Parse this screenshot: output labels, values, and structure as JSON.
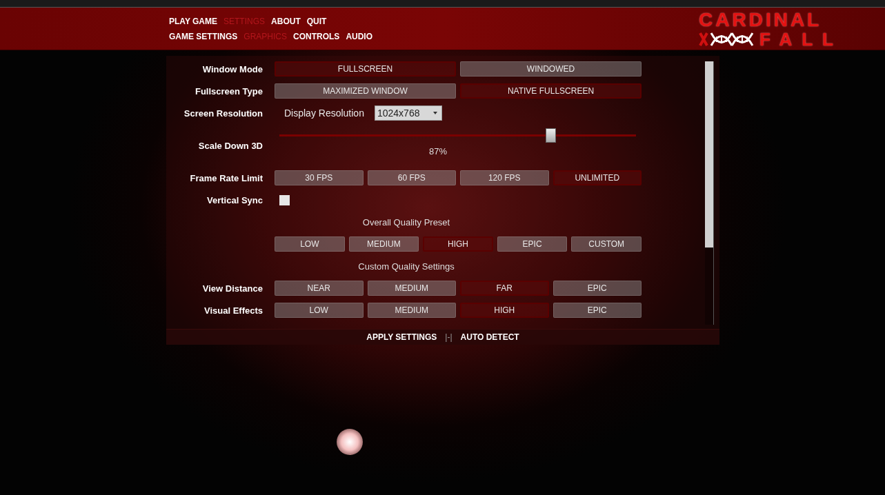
{
  "menu": [
    {
      "label": "PLAY GAME",
      "selected": false
    },
    {
      "label": "SETTINGS",
      "selected": true
    },
    {
      "label": "ABOUT",
      "selected": false
    },
    {
      "label": "QUIT",
      "selected": false
    }
  ],
  "submenu": [
    {
      "label": "GAME SETTINGS",
      "selected": false
    },
    {
      "label": "GRAPHICS",
      "selected": true
    },
    {
      "label": "CONTROLS",
      "selected": false
    },
    {
      "label": "AUDIO",
      "selected": false
    }
  ],
  "logo": {
    "line_1": "CARDINAL",
    "line_2": "FALL"
  },
  "rows": [
    {
      "kind": "options",
      "label": "Window Mode",
      "options": [
        {
          "label": "FULLSCREEN",
          "selected": true
        },
        {
          "label": "WINDOWED",
          "selected": false
        }
      ]
    },
    {
      "kind": "options",
      "label": "Fullscreen Type",
      "options": [
        {
          "label": "MAXIMIZED WINDOW",
          "selected": false
        },
        {
          "label": "NATIVE FULLSCREEN",
          "selected": true
        }
      ]
    },
    {
      "kind": "dropdown",
      "label": "Screen Resolution",
      "field_label": "Display Resolution",
      "value": "1024x768"
    },
    {
      "kind": "slider",
      "label": "Scale Down 3D",
      "level": 0.76,
      "reading": "87%"
    },
    {
      "kind": "options",
      "label": "Frame Rate Limit",
      "options": [
        {
          "label": "30 FPS",
          "selected": false
        },
        {
          "label": "60 FPS",
          "selected": false
        },
        {
          "label": "120 FPS",
          "selected": false
        },
        {
          "label": "UNLIMITED",
          "selected": true
        }
      ]
    },
    {
      "kind": "checkbox",
      "label": "Vertical Sync",
      "checked": false
    },
    {
      "kind": "heading",
      "text": "Overall Quality Preset"
    },
    {
      "kind": "options",
      "options": [
        {
          "label": "LOW",
          "selected": false
        },
        {
          "label": "MEDIUM",
          "selected": false
        },
        {
          "label": "HIGH",
          "selected": true
        },
        {
          "label": "EPIC",
          "selected": false
        },
        {
          "label": "CUSTOM",
          "selected": false
        }
      ]
    },
    {
      "kind": "heading",
      "text": "Custom Quality Settings"
    },
    {
      "kind": "options",
      "label": "View Distance",
      "options": [
        {
          "label": "NEAR",
          "selected": false
        },
        {
          "label": "MEDIUM",
          "selected": false
        },
        {
          "label": "FAR",
          "selected": true
        },
        {
          "label": "EPIC",
          "selected": false
        }
      ]
    },
    {
      "kind": "options",
      "label": "Visual Effects",
      "options": [
        {
          "label": "LOW",
          "selected": false
        },
        {
          "label": "MEDIUM",
          "selected": false
        },
        {
          "label": "HIGH",
          "selected": true
        },
        {
          "label": "EPIC",
          "selected": false
        }
      ]
    }
  ],
  "footer": {
    "apply": "APPLY SETTINGS",
    "separator": "|-|",
    "detect": "AUTO DETECT"
  }
}
